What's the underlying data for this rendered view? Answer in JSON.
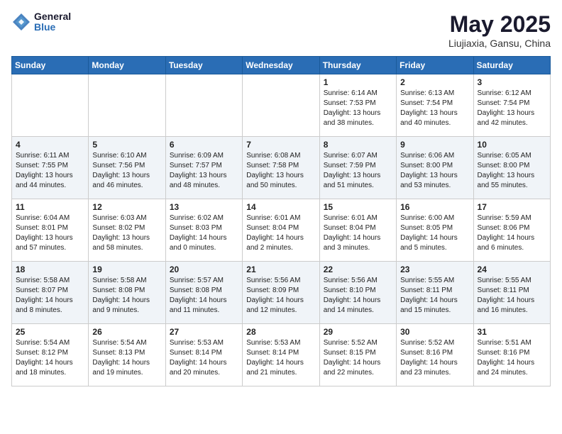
{
  "logo": {
    "general": "General",
    "blue": "Blue"
  },
  "header": {
    "title": "May 2025",
    "location": "Liujiaxia, Gansu, China"
  },
  "days_of_week": [
    "Sunday",
    "Monday",
    "Tuesday",
    "Wednesday",
    "Thursday",
    "Friday",
    "Saturday"
  ],
  "weeks": [
    [
      {
        "day": "",
        "content": ""
      },
      {
        "day": "",
        "content": ""
      },
      {
        "day": "",
        "content": ""
      },
      {
        "day": "",
        "content": ""
      },
      {
        "day": "1",
        "content": "Sunrise: 6:14 AM\nSunset: 7:53 PM\nDaylight: 13 hours\nand 38 minutes."
      },
      {
        "day": "2",
        "content": "Sunrise: 6:13 AM\nSunset: 7:54 PM\nDaylight: 13 hours\nand 40 minutes."
      },
      {
        "day": "3",
        "content": "Sunrise: 6:12 AM\nSunset: 7:54 PM\nDaylight: 13 hours\nand 42 minutes."
      }
    ],
    [
      {
        "day": "4",
        "content": "Sunrise: 6:11 AM\nSunset: 7:55 PM\nDaylight: 13 hours\nand 44 minutes."
      },
      {
        "day": "5",
        "content": "Sunrise: 6:10 AM\nSunset: 7:56 PM\nDaylight: 13 hours\nand 46 minutes."
      },
      {
        "day": "6",
        "content": "Sunrise: 6:09 AM\nSunset: 7:57 PM\nDaylight: 13 hours\nand 48 minutes."
      },
      {
        "day": "7",
        "content": "Sunrise: 6:08 AM\nSunset: 7:58 PM\nDaylight: 13 hours\nand 50 minutes."
      },
      {
        "day": "8",
        "content": "Sunrise: 6:07 AM\nSunset: 7:59 PM\nDaylight: 13 hours\nand 51 minutes."
      },
      {
        "day": "9",
        "content": "Sunrise: 6:06 AM\nSunset: 8:00 PM\nDaylight: 13 hours\nand 53 minutes."
      },
      {
        "day": "10",
        "content": "Sunrise: 6:05 AM\nSunset: 8:00 PM\nDaylight: 13 hours\nand 55 minutes."
      }
    ],
    [
      {
        "day": "11",
        "content": "Sunrise: 6:04 AM\nSunset: 8:01 PM\nDaylight: 13 hours\nand 57 minutes."
      },
      {
        "day": "12",
        "content": "Sunrise: 6:03 AM\nSunset: 8:02 PM\nDaylight: 13 hours\nand 58 minutes."
      },
      {
        "day": "13",
        "content": "Sunrise: 6:02 AM\nSunset: 8:03 PM\nDaylight: 14 hours\nand 0 minutes."
      },
      {
        "day": "14",
        "content": "Sunrise: 6:01 AM\nSunset: 8:04 PM\nDaylight: 14 hours\nand 2 minutes."
      },
      {
        "day": "15",
        "content": "Sunrise: 6:01 AM\nSunset: 8:04 PM\nDaylight: 14 hours\nand 3 minutes."
      },
      {
        "day": "16",
        "content": "Sunrise: 6:00 AM\nSunset: 8:05 PM\nDaylight: 14 hours\nand 5 minutes."
      },
      {
        "day": "17",
        "content": "Sunrise: 5:59 AM\nSunset: 8:06 PM\nDaylight: 14 hours\nand 6 minutes."
      }
    ],
    [
      {
        "day": "18",
        "content": "Sunrise: 5:58 AM\nSunset: 8:07 PM\nDaylight: 14 hours\nand 8 minutes."
      },
      {
        "day": "19",
        "content": "Sunrise: 5:58 AM\nSunset: 8:08 PM\nDaylight: 14 hours\nand 9 minutes."
      },
      {
        "day": "20",
        "content": "Sunrise: 5:57 AM\nSunset: 8:08 PM\nDaylight: 14 hours\nand 11 minutes."
      },
      {
        "day": "21",
        "content": "Sunrise: 5:56 AM\nSunset: 8:09 PM\nDaylight: 14 hours\nand 12 minutes."
      },
      {
        "day": "22",
        "content": "Sunrise: 5:56 AM\nSunset: 8:10 PM\nDaylight: 14 hours\nand 14 minutes."
      },
      {
        "day": "23",
        "content": "Sunrise: 5:55 AM\nSunset: 8:11 PM\nDaylight: 14 hours\nand 15 minutes."
      },
      {
        "day": "24",
        "content": "Sunrise: 5:55 AM\nSunset: 8:11 PM\nDaylight: 14 hours\nand 16 minutes."
      }
    ],
    [
      {
        "day": "25",
        "content": "Sunrise: 5:54 AM\nSunset: 8:12 PM\nDaylight: 14 hours\nand 18 minutes."
      },
      {
        "day": "26",
        "content": "Sunrise: 5:54 AM\nSunset: 8:13 PM\nDaylight: 14 hours\nand 19 minutes."
      },
      {
        "day": "27",
        "content": "Sunrise: 5:53 AM\nSunset: 8:14 PM\nDaylight: 14 hours\nand 20 minutes."
      },
      {
        "day": "28",
        "content": "Sunrise: 5:53 AM\nSunset: 8:14 PM\nDaylight: 14 hours\nand 21 minutes."
      },
      {
        "day": "29",
        "content": "Sunrise: 5:52 AM\nSunset: 8:15 PM\nDaylight: 14 hours\nand 22 minutes."
      },
      {
        "day": "30",
        "content": "Sunrise: 5:52 AM\nSunset: 8:16 PM\nDaylight: 14 hours\nand 23 minutes."
      },
      {
        "day": "31",
        "content": "Sunrise: 5:51 AM\nSunset: 8:16 PM\nDaylight: 14 hours\nand 24 minutes."
      }
    ]
  ]
}
